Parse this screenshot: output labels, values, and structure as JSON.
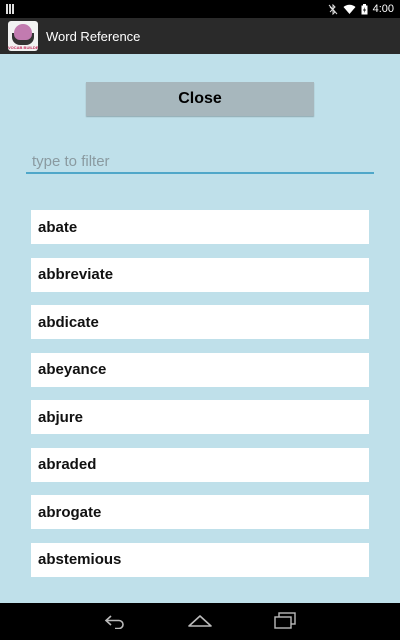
{
  "status_bar": {
    "time": "4:00",
    "icons": [
      "notification-icon",
      "bluetooth-muted-icon",
      "wifi-icon",
      "battery-icon"
    ]
  },
  "action_bar": {
    "title": "Word Reference",
    "app_icon": "vocab-builder-brain-icon",
    "app_icon_text": "VOCAB BUILDER"
  },
  "close_button": {
    "label": "Close"
  },
  "filter": {
    "placeholder": "type to filter",
    "value": ""
  },
  "words": [
    "abate",
    "abbreviate",
    "abdicate",
    "abeyance",
    "abjure",
    "abraded",
    "abrogate",
    "abstemious"
  ],
  "nav_bar": {
    "icons": [
      "back-icon",
      "home-icon",
      "recents-icon"
    ]
  },
  "colors": {
    "background": "#bfe0ea",
    "action_bar": "#2a2a2a",
    "close_button": "#a7b7bd",
    "filter_underline": "#4fa7c9",
    "list_item": "#ffffff"
  }
}
